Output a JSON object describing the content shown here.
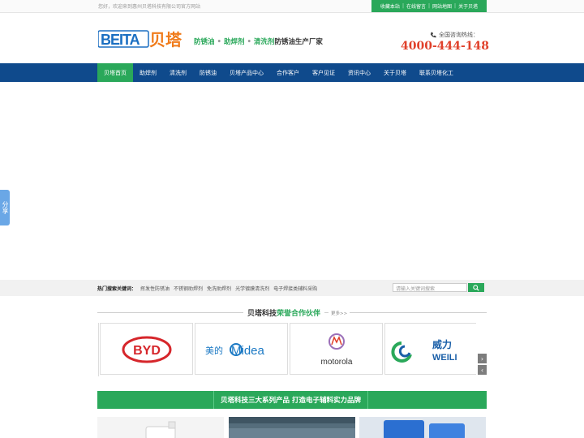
{
  "topbar": {
    "welcome": "您好，欢迎来到惠州贝塔科技有限公司官方网站",
    "links": [
      "收藏本站",
      "在线留言",
      "网站地图",
      "关于贝塔"
    ]
  },
  "header": {
    "logo_text": "BEITA贝塔",
    "slogan": {
      "item1": "防锈油",
      "item2": "助焊剂",
      "item3": "清洗剂",
      "suffix": "防锈油生产厂家"
    },
    "hotline_label": "全国咨询热线：",
    "hotline_number": "4000-444-148"
  },
  "nav": {
    "items": [
      "贝塔首页",
      "助焊剂",
      "清洗剂",
      "防锈油",
      "贝塔产品中心",
      "合作客户",
      "客户见证",
      "资讯中心",
      "关于贝塔",
      "联系贝塔化工"
    ]
  },
  "share": {
    "label": "分享"
  },
  "keywords": {
    "label": "热门搜索关键词：",
    "items": [
      "挥发性防锈油",
      "不锈钢助焊剂",
      "免洗助焊剂",
      "光学镀膜清洗剂",
      "电子焊接类辅料采购"
    ]
  },
  "search": {
    "placeholder": "请输入关键词搜索"
  },
  "partners": {
    "title_prefix": "贝塔科技",
    "title_highlight": "荣誉合作伙伴",
    "more": "更多>>",
    "logos": [
      {
        "name": "BYD",
        "color": "#d6262b"
      },
      {
        "name_cn": "美的",
        "name_en": "Midea",
        "color": "#1b79c4"
      },
      {
        "name": "motorola",
        "color": "#333333"
      },
      {
        "name_cn": "威力",
        "name_en": "WEILI",
        "color": "#1a5fa8"
      }
    ]
  },
  "series": {
    "title": "贝塔科技三大系列产品 打造电子辅料实力品牌"
  },
  "colors": {
    "green": "#2aa85a",
    "navy": "#0f4a8c",
    "red": "#e0402a"
  }
}
